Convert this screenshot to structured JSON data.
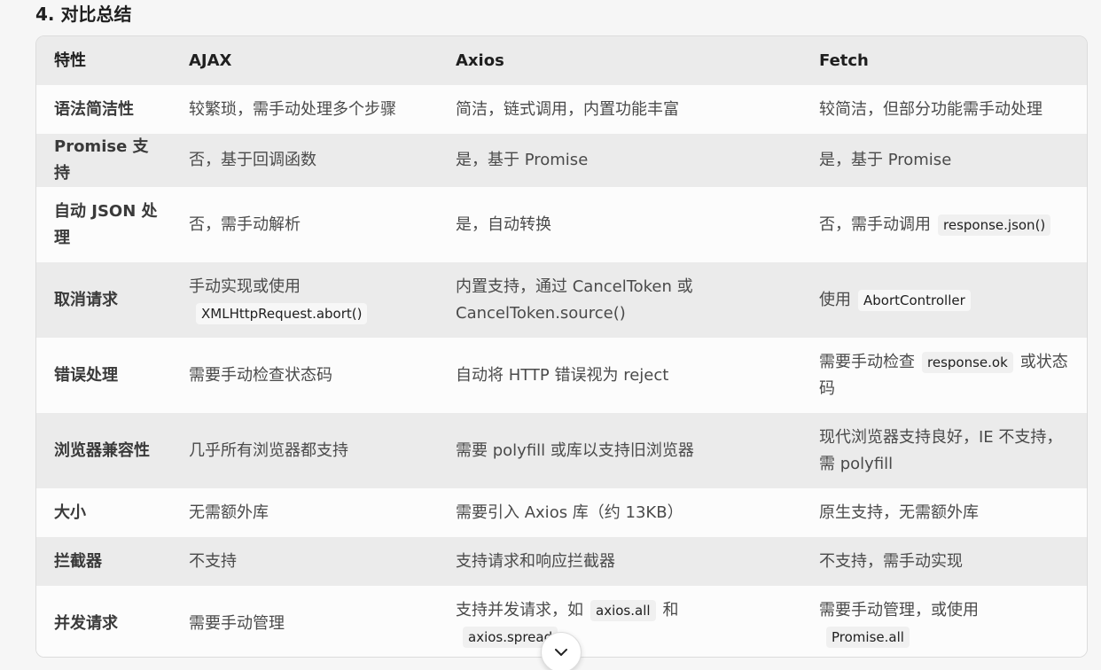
{
  "heading": "4. 对比总结",
  "table": {
    "headers": [
      "特性",
      "AJAX",
      "Axios",
      "Fetch"
    ],
    "rows": [
      {
        "feature": "语法简洁性",
        "ajax": "较繁琐，需手动处理多个步骤",
        "axios": "简洁，链式调用，内置功能丰富",
        "fetch": "较简洁，但部分功能需手动处理"
      },
      {
        "feature": "Promise 支持",
        "ajax": "否，基于回调函数",
        "axios": "是，基于 Promise",
        "fetch": "是，基于 Promise"
      },
      {
        "feature": "自动 JSON 处理",
        "ajax": "否，需手动解析",
        "axios": "是，自动转换",
        "fetch_text": "否，需手动调用",
        "fetch_code": "response.json()"
      },
      {
        "feature": "取消请求",
        "ajax_text": "手动实现或使用",
        "ajax_code": "XMLHttpRequest.abort()",
        "axios_line1": "内置支持，通过 CancelToken 或",
        "axios_line2": "CancelToken.source()",
        "fetch_text": "使用",
        "fetch_code": "AbortController"
      },
      {
        "feature": "错误处理",
        "ajax": "需要手动检查状态码",
        "axios": "自动将 HTTP 错误视为 reject",
        "fetch_text1": "需要手动检查",
        "fetch_code": "response.ok",
        "fetch_text2": "或状态码"
      },
      {
        "feature": "浏览器兼容性",
        "ajax": "几乎所有浏览器都支持",
        "axios": "需要 polyfill 或库以支持旧浏览器",
        "fetch": "现代浏览器支持良好，IE 不支持，需 polyfill"
      },
      {
        "feature": "大小",
        "ajax": "无需额外库",
        "axios": "需要引入 Axios 库（约 13KB）",
        "fetch": "原生支持，无需额外库"
      },
      {
        "feature": "拦截器",
        "ajax": "不支持",
        "axios": "支持请求和响应拦截器",
        "fetch": "不支持，需手动实现"
      },
      {
        "feature": "并发请求",
        "ajax": "需要手动管理",
        "axios_text1": "支持并发请求，如",
        "axios_code1": "axios.all",
        "axios_text2": "和",
        "axios_code2": "axios.spread",
        "fetch_text": "需要手动管理，或使用",
        "fetch_code": "Promise.all"
      }
    ]
  },
  "scroll_button": {
    "icon": "chevron-down-icon"
  }
}
